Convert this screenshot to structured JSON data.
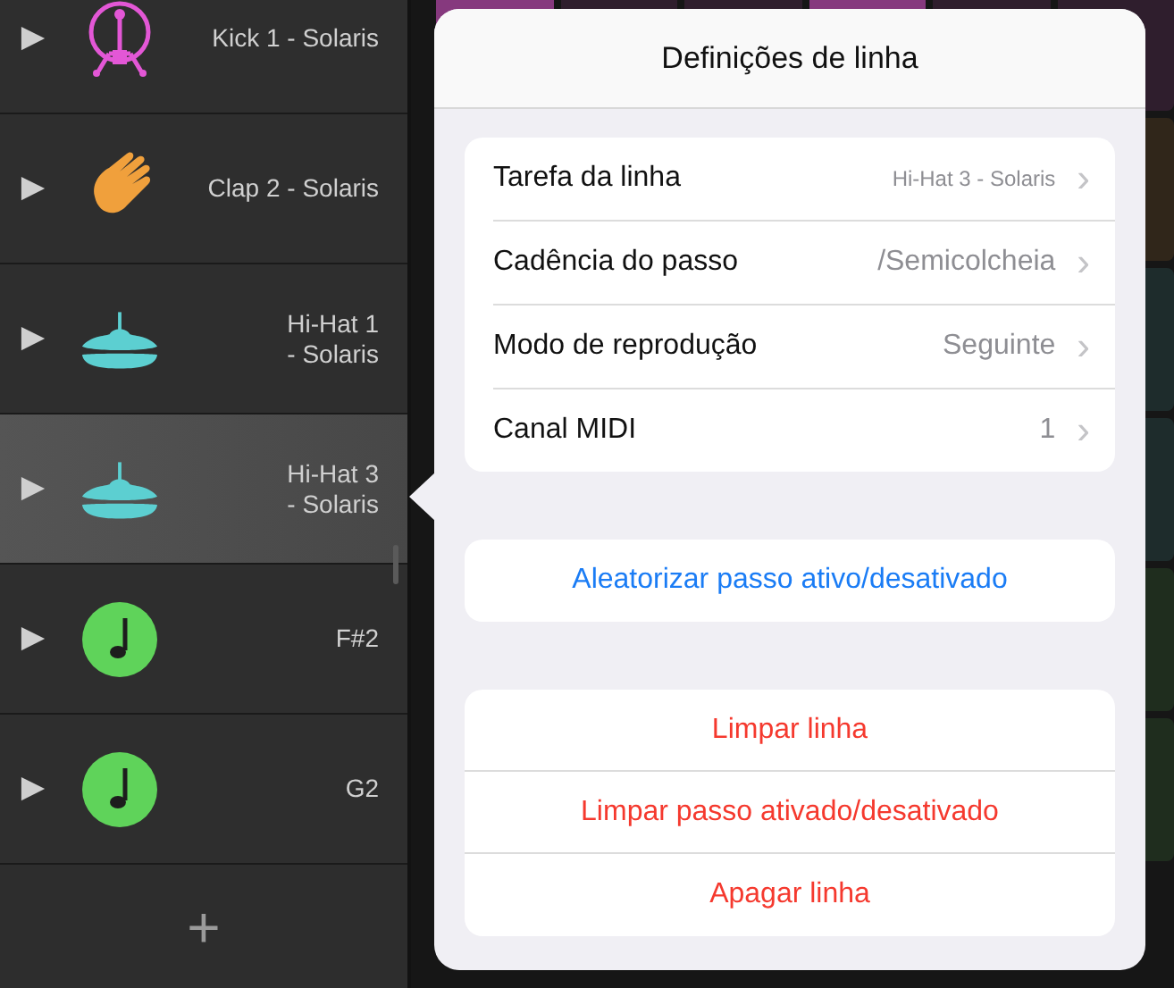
{
  "tracks": [
    {
      "kind": "kick",
      "name": "Kick 1 - Solaris",
      "color": "#e357d6",
      "selected": false
    },
    {
      "kind": "clap",
      "name": "Clap 2 - Solaris",
      "color": "#f0a03c",
      "selected": false
    },
    {
      "kind": "hihat",
      "name": "Hi-Hat 1\n- Solaris",
      "color": "#5ccfd1",
      "selected": false
    },
    {
      "kind": "hihat",
      "name": "Hi-Hat 3\n- Solaris",
      "color": "#5ccfd1",
      "selected": true
    },
    {
      "kind": "note",
      "name": "F#2",
      "color": "#5fd35a",
      "selected": false
    },
    {
      "kind": "note",
      "name": "G2",
      "color": "#5fd35a",
      "selected": false
    }
  ],
  "add_button": "+",
  "popover": {
    "title": "Definições de linha",
    "settings": [
      {
        "label": "Tarefa da linha",
        "value": "Hi-Hat 3 - Solaris",
        "compact": true
      },
      {
        "label": "Cadência do passo",
        "value": "/Semicolcheia",
        "compact": false
      },
      {
        "label": "Modo de reprodução",
        "value": "Seguinte",
        "compact": false
      },
      {
        "label": "Canal MIDI",
        "value": "1",
        "compact": false
      }
    ],
    "chevron": "›",
    "action_groups": [
      [
        {
          "label": "Aleatorizar passo ativo/desativado",
          "kind": "normal"
        }
      ],
      [
        {
          "label": "Limpar linha",
          "kind": "destructive"
        },
        {
          "label": "Limpar passo ativado/desativado",
          "kind": "destructive"
        },
        {
          "label": "Apagar linha",
          "kind": "destructive"
        }
      ]
    ]
  }
}
